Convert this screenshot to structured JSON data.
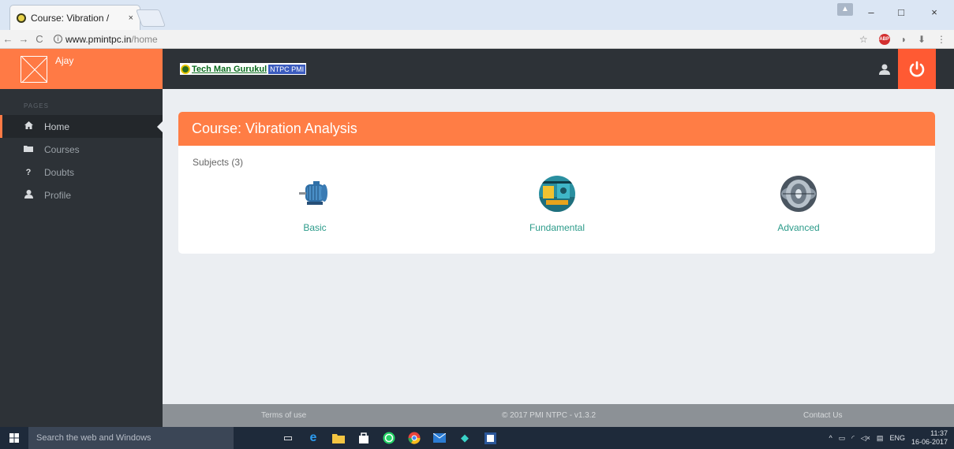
{
  "browser": {
    "tab_title": "Course: Vibration /",
    "tab_close": "×",
    "url_host": "www.pmintpc.in",
    "url_path": "/home",
    "win_min": "–",
    "win_max": "□",
    "win_close": "×"
  },
  "app": {
    "user_name": "Ajay",
    "brand_name": "Tech Man Gurukul",
    "brand_tag": "NTPC PMI",
    "sidebar_section": "PAGES",
    "nav": [
      {
        "label": "Home",
        "icon": "home-icon"
      },
      {
        "label": "Courses",
        "icon": "folder-icon"
      },
      {
        "label": "Doubts",
        "icon": "question-icon"
      },
      {
        "label": "Profile",
        "icon": "user-icon"
      }
    ],
    "accent": "#ff7a45"
  },
  "course": {
    "title": "Course: Vibration Analysis",
    "subjects_label": "Subjects (3)",
    "subjects": [
      {
        "name": "Basic",
        "icon": "motor-icon"
      },
      {
        "name": "Fundamental",
        "icon": "machinery-icon"
      },
      {
        "name": "Advanced",
        "icon": "turbine-icon"
      }
    ]
  },
  "footer": {
    "terms": "Terms of use",
    "copyright": "© 2017 PMI NTPC - v1.3.2",
    "contact": "Contact Us"
  },
  "taskbar": {
    "search_placeholder": "Search the web and Windows",
    "lang": "ENG",
    "time": "11:37",
    "date": "16-06-2017"
  }
}
